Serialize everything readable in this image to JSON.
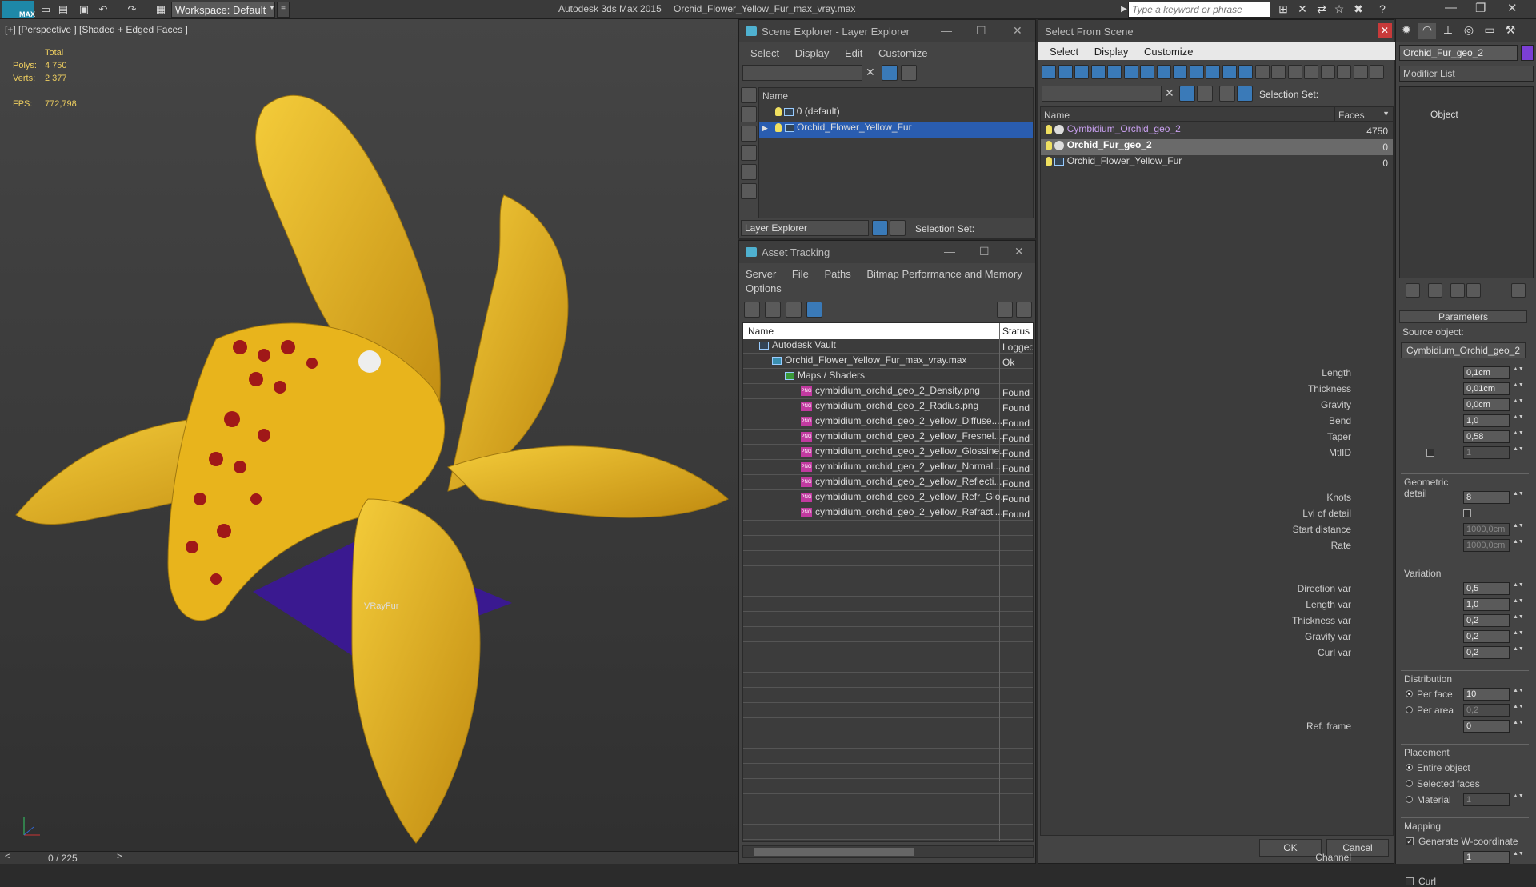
{
  "topbar": {
    "logo": "MAX",
    "workspace": "Workspace: Default",
    "app_title": "Autodesk 3ds Max  2015",
    "file_title": "Orchid_Flower_Yellow_Fur_max_vray.max",
    "search_placeholder": "Type a keyword or phrase"
  },
  "viewport": {
    "label": "[+] [Perspective ] [Shaded + Edged Faces ]",
    "stats_header": "Total",
    "polys_label": "Polys:",
    "polys_value": "4 750",
    "verts_label": "Verts:",
    "verts_value": "2 377",
    "fps_label": "FPS:",
    "fps_value": "772,798",
    "object_label": "VRayFur",
    "frame_counter": "0 / 225",
    "colors": {
      "petal": "#e8b41c",
      "spot": "#a01818",
      "plane": "#3a1990"
    }
  },
  "scene_explorer": {
    "title": "Scene Explorer - Layer Explorer",
    "menu": [
      "Select",
      "Display",
      "Edit",
      "Customize"
    ],
    "column_name": "Name",
    "rows": [
      {
        "label": "0 (default)"
      },
      {
        "label": "Orchid_Flower_Yellow_Fur"
      }
    ],
    "footer_dropdown": "Layer Explorer",
    "footer_selection": "Selection Set:"
  },
  "asset_tracking": {
    "title": "Asset Tracking",
    "menu": [
      "Server",
      "File",
      "Paths",
      "Bitmap Performance and Memory"
    ],
    "menu2": "Options",
    "col_name": "Name",
    "col_status": "Status",
    "rows": [
      {
        "name": "Autodesk Vault",
        "status": "Logged"
      },
      {
        "name": "Orchid_Flower_Yellow_Fur_max_vray.max",
        "status": "Ok"
      },
      {
        "name": "Maps / Shaders",
        "status": ""
      },
      {
        "name": "cymbidium_orchid_geo_2_Density.png",
        "status": "Found"
      },
      {
        "name": "cymbidium_orchid_geo_2_Radius.png",
        "status": "Found"
      },
      {
        "name": "cymbidium_orchid_geo_2_yellow_Diffuse....",
        "status": "Found"
      },
      {
        "name": "cymbidium_orchid_geo_2_yellow_Fresnel....",
        "status": "Found"
      },
      {
        "name": "cymbidium_orchid_geo_2_yellow_Glossine...",
        "status": "Found"
      },
      {
        "name": "cymbidium_orchid_geo_2_yellow_Normal....",
        "status": "Found"
      },
      {
        "name": "cymbidium_orchid_geo_2_yellow_Reflecti...",
        "status": "Found"
      },
      {
        "name": "cymbidium_orchid_geo_2_yellow_Refr_Glo...",
        "status": "Found"
      },
      {
        "name": "cymbidium_orchid_geo_2_yellow_Refracti...",
        "status": "Found"
      }
    ]
  },
  "select_from_scene": {
    "title": "Select From Scene",
    "menu": [
      "Select",
      "Display",
      "Customize"
    ],
    "selection_set": "Selection Set:",
    "col_name": "Name",
    "col_faces": "Faces",
    "rows": [
      {
        "name": "Cymbidium_Orchid_geo_2",
        "faces": "4750"
      },
      {
        "name": "Orchid_Fur_geo_2",
        "faces": "0"
      },
      {
        "name": "Orchid_Flower_Yellow_Fur",
        "faces": "0"
      }
    ],
    "ok": "OK",
    "cancel": "Cancel"
  },
  "command_panel": {
    "object_name": "Orchid_Fur_geo_2",
    "object_color": "#7b3fd6",
    "modifier_list": "Modifier List",
    "stack_item": "Object",
    "rollout": "Parameters",
    "source_label": "Source object:",
    "source_value": "Cymbidium_Orchid_geo_2",
    "params": [
      {
        "label": "Length",
        "value": "0,1cm"
      },
      {
        "label": "Thickness",
        "value": "0,01cm"
      },
      {
        "label": "Gravity",
        "value": "0,0cm"
      },
      {
        "label": "Bend",
        "value": "1,0"
      },
      {
        "label": "Taper",
        "value": "0,58"
      },
      {
        "label": "MtlID",
        "value": "1"
      }
    ],
    "geo_header": "Geometric detail",
    "geo": [
      {
        "label": "Knots",
        "value": "8"
      },
      {
        "label": "Lvl of detail",
        "value": ""
      },
      {
        "label": "Start distance",
        "value": "1000,0cm"
      },
      {
        "label": "Rate",
        "value": "1000,0cm"
      }
    ],
    "var_header": "Variation",
    "variation": [
      {
        "label": "Direction var",
        "value": "0,5"
      },
      {
        "label": "Length var",
        "value": "1,0"
      },
      {
        "label": "Thickness var",
        "value": "0,2"
      },
      {
        "label": "Gravity var",
        "value": "0,2"
      },
      {
        "label": "Curl var",
        "value": "0,2"
      }
    ],
    "dist_header": "Distribution",
    "dist": [
      {
        "label": "Per face",
        "value": "10"
      },
      {
        "label": "Per area",
        "value": "0,2"
      },
      {
        "label": "Ref. frame",
        "value": "0"
      }
    ],
    "place_header": "Placement",
    "placement": [
      "Entire object",
      "Selected faces",
      "Material"
    ],
    "material_value": "1",
    "map_header": "Mapping",
    "gen_w": "Generate W-coordinate",
    "channel_label": "Channel",
    "channel_value": "1",
    "curl": "Curl"
  }
}
